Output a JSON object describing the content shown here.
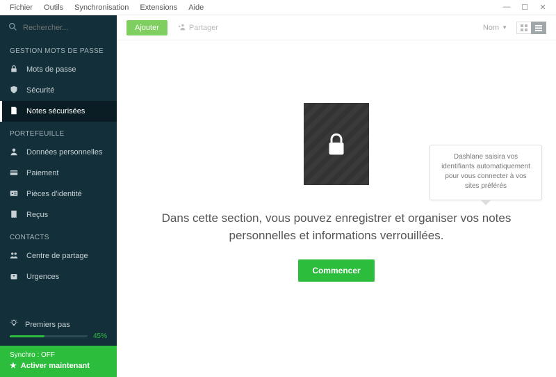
{
  "menubar": {
    "items": [
      "Fichier",
      "Outils",
      "Synchronisation",
      "Extensions",
      "Aide"
    ]
  },
  "sidebar": {
    "search_placeholder": "Rechercher...",
    "sections": [
      {
        "title": "GESTION MOTS DE PASSE",
        "items": [
          {
            "label": "Mots de passe",
            "icon": "lock-icon",
            "active": false
          },
          {
            "label": "Sécurité",
            "icon": "shield-icon",
            "active": false
          },
          {
            "label": "Notes sécurisées",
            "icon": "note-icon",
            "active": true
          }
        ]
      },
      {
        "title": "PORTEFEUILLE",
        "items": [
          {
            "label": "Données personnelles",
            "icon": "person-icon",
            "active": false
          },
          {
            "label": "Paiement",
            "icon": "card-icon",
            "active": false
          },
          {
            "label": "Pièces d'identité",
            "icon": "id-icon",
            "active": false
          },
          {
            "label": "Reçus",
            "icon": "receipt-icon",
            "active": false
          }
        ]
      },
      {
        "title": "CONTACTS",
        "items": [
          {
            "label": "Centre de partage",
            "icon": "share-icon",
            "active": false
          },
          {
            "label": "Urgences",
            "icon": "emergency-icon",
            "active": false
          }
        ]
      }
    ],
    "first_steps": {
      "label": "Premiers pas",
      "percent_label": "45%",
      "percent": 45
    },
    "sync": {
      "status": "Synchro : OFF",
      "cta": "Activer maintenant"
    }
  },
  "toolbar": {
    "add_label": "Ajouter",
    "share_label": "Partager",
    "sort_label": "Nom"
  },
  "empty_state": {
    "message": "Dans cette section, vous pouvez enregistrer et organiser vos notes personnelles et informations verrouillées.",
    "cta": "Commencer"
  },
  "hint": {
    "text": "Dashlane saisira vos identifiants automatiquement pour vous connecter à vos sites préférés"
  }
}
